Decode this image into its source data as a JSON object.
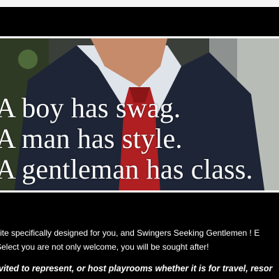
{
  "hero": {
    "quote_lines": [
      "A boy has swag.",
      "A man has style.",
      "A gentleman has class."
    ]
  },
  "body": {
    "line1": "site specifically designed for you, and Swingers Seeking Gentlemen ! E",
    "line2": "Select you are not only welcome, you will be sought after!",
    "line3": "vited to represent, or host playrooms whether it is for travel, resor"
  },
  "colors": {
    "background": "#000000",
    "top_bar": "#f5f5f5",
    "tie": "#b01f22",
    "suit": "#1d2536"
  }
}
